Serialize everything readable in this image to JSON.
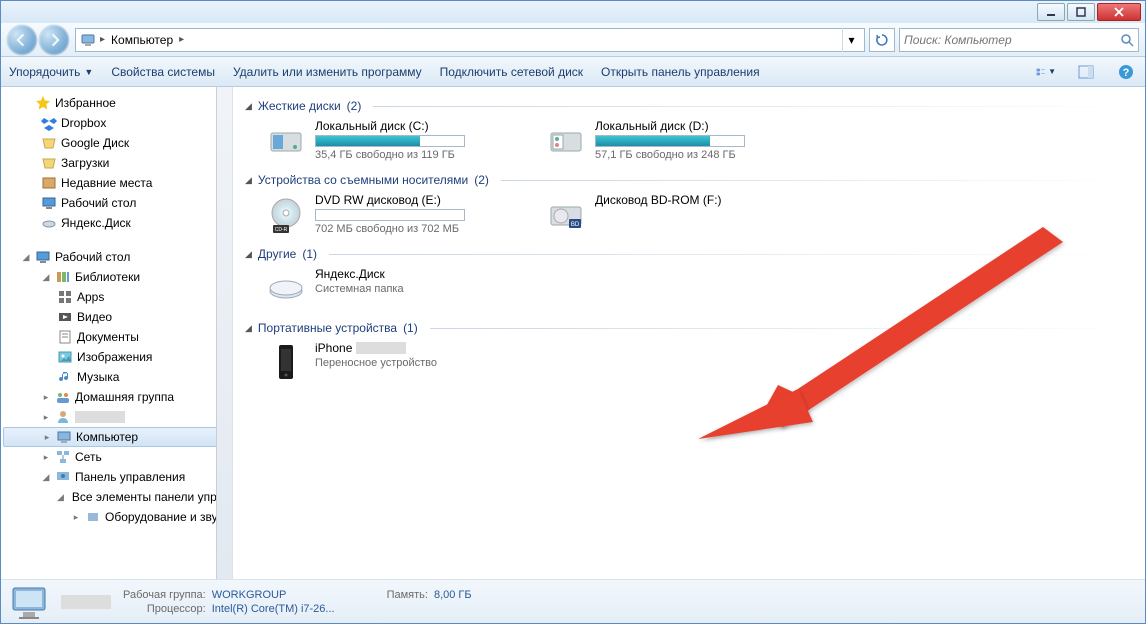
{
  "titlebar": {},
  "breadcrumb": {
    "location": "Компьютер"
  },
  "search": {
    "placeholder": "Поиск: Компьютер"
  },
  "toolbar": {
    "organize": "Упорядочить",
    "properties": "Свойства системы",
    "uninstall": "Удалить или изменить программу",
    "mapdrive": "Подключить сетевой диск",
    "controlpanel": "Открыть панель управления"
  },
  "sidebar": {
    "favorites": "Избранное",
    "fav": [
      "Dropbox",
      "Google Диск",
      "Загрузки",
      "Недавние места",
      "Рабочий стол",
      "Яндекс.Диск"
    ],
    "desktop": "Рабочий стол",
    "libraries": "Библиотеки",
    "libs": [
      "Apps",
      "Видео",
      "Документы",
      "Изображения",
      "Музыка"
    ],
    "homegroup": "Домашняя группа",
    "user_blurred": " ",
    "computer": "Компьютер",
    "network": "Сеть",
    "cpanel": "Панель управления",
    "allcp": "Все элементы панели управле",
    "hw": "Оборудование и звук"
  },
  "groups": {
    "hdd": {
      "title": "Жесткие диски",
      "count": "(2)"
    },
    "removable": {
      "title": "Устройства со съемными носителями",
      "count": "(2)"
    },
    "other": {
      "title": "Другие",
      "count": "(1)"
    },
    "portable": {
      "title": "Портативные устройства",
      "count": "(1)"
    }
  },
  "drives": {
    "c": {
      "name": "Локальный диск (C:)",
      "status": "35,4 ГБ свободно из 119 ГБ",
      "fill": 70
    },
    "d": {
      "name": "Локальный диск (D:)",
      "status": "57,1 ГБ свободно из 248 ГБ",
      "fill": 77
    },
    "e": {
      "name": "DVD RW дисковод (E:)",
      "status": "702 МБ свободно из 702 МБ",
      "fill": 0
    },
    "f": {
      "name": "Дисковод BD-ROM (F:)",
      "status": ""
    },
    "yadisk": {
      "name": "Яндекс.Диск",
      "status": "Системная папка"
    },
    "iphone": {
      "name": "iPhone",
      "status": "Переносное устройство"
    }
  },
  "status": {
    "workgroup_label": "Рабочая группа:",
    "workgroup": "WORKGROUP",
    "cpu_label": "Процессор:",
    "cpu": "Intel(R) Core(TM) i7-26...",
    "mem_label": "Память:",
    "mem": "8,00 ГБ"
  }
}
